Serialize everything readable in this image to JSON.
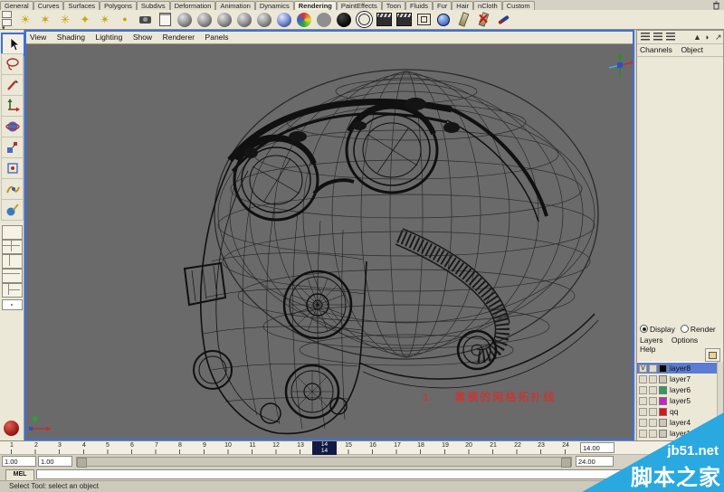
{
  "menu_tabs": [
    "General",
    "Curves",
    "Surfaces",
    "Polygons",
    "Subdivs",
    "Deformation",
    "Animation",
    "Dynamics",
    "Rendering",
    "PaintEffects",
    "Toon",
    "Fluids",
    "Fur",
    "Hair",
    "nCloth",
    "Custom"
  ],
  "active_tab": "Rendering",
  "shelf_icons": [
    "ambient-light",
    "directional-light",
    "point-light",
    "spot-light",
    "area-light",
    "volume-light",
    "camera",
    "render-globals-page",
    "anisotropic-material",
    "blinn-material",
    "lambert-material",
    "phong-material",
    "phong-e-material",
    "ramp-shader",
    "surface-shader",
    "use-background",
    "black-material",
    "shading-map-ring",
    "render-current-frame",
    "ipr-render",
    "render-settings",
    "hypershade-globe",
    "paint-effects-tube",
    "delete-unused-red-x",
    "paint-effects-brush"
  ],
  "toolbox_icons": [
    "select-tool",
    "lasso-select-tool",
    "paint-select-tool",
    "move-tool",
    "rotate-tool",
    "scale-tool",
    "universal-manipulator-tool",
    "soft-modification-tool",
    "show-manipulator-tool",
    "single-pane-layout",
    "four-pane-layout",
    "split-left-layout",
    "split-top-layout",
    "outliner-pane-layout",
    "red-badge"
  ],
  "viewport": {
    "menu": [
      "View",
      "Shading",
      "Lighting",
      "Show",
      "Renderer",
      "Panels"
    ],
    "annotation": "1.    素模的网格拓扑线",
    "annotation_color": "#c03a3a",
    "background": "#6a6a6a"
  },
  "right_panel": {
    "tabs": [
      "Channels",
      "Object"
    ],
    "layer_editor": {
      "display_label": "Display",
      "render_label": "Render",
      "menu": [
        "Layers",
        "Options",
        "Help"
      ],
      "layers": [
        {
          "visible": "V",
          "swatch": "#000000",
          "name": "layer8",
          "selected": true
        },
        {
          "visible": "",
          "swatch": "",
          "name": "layer7",
          "selected": false
        },
        {
          "visible": "",
          "swatch": "#2e9e5b",
          "name": "layer6",
          "selected": false
        },
        {
          "visible": "",
          "swatch": "#c428c4",
          "name": "layer5",
          "selected": false
        },
        {
          "visible": "",
          "swatch": "#dd1515",
          "name": "qq",
          "selected": false
        },
        {
          "visible": "",
          "swatch": "",
          "name": "layer4",
          "selected": false
        },
        {
          "visible": "",
          "swatch": "",
          "name": "layer1",
          "selected": false
        }
      ]
    }
  },
  "timeline": {
    "frames": [
      "1",
      "2",
      "3",
      "4",
      "5",
      "6",
      "7",
      "8",
      "9",
      "10",
      "11",
      "12",
      "13",
      "14",
      "15",
      "16",
      "17",
      "18",
      "19",
      "20",
      "21",
      "22",
      "23",
      "24"
    ],
    "current_frame": "14",
    "current_time": "14.00",
    "range_start": "1.00",
    "anim_start": "1.00",
    "range_end": "24.00"
  },
  "command_line": {
    "label": "MEL",
    "value": ""
  },
  "help_line": {
    "text": "Select Tool: select an object"
  },
  "watermark": {
    "site": "jb51.net",
    "name": "脚本之家",
    "color": "#2aa8e0"
  }
}
